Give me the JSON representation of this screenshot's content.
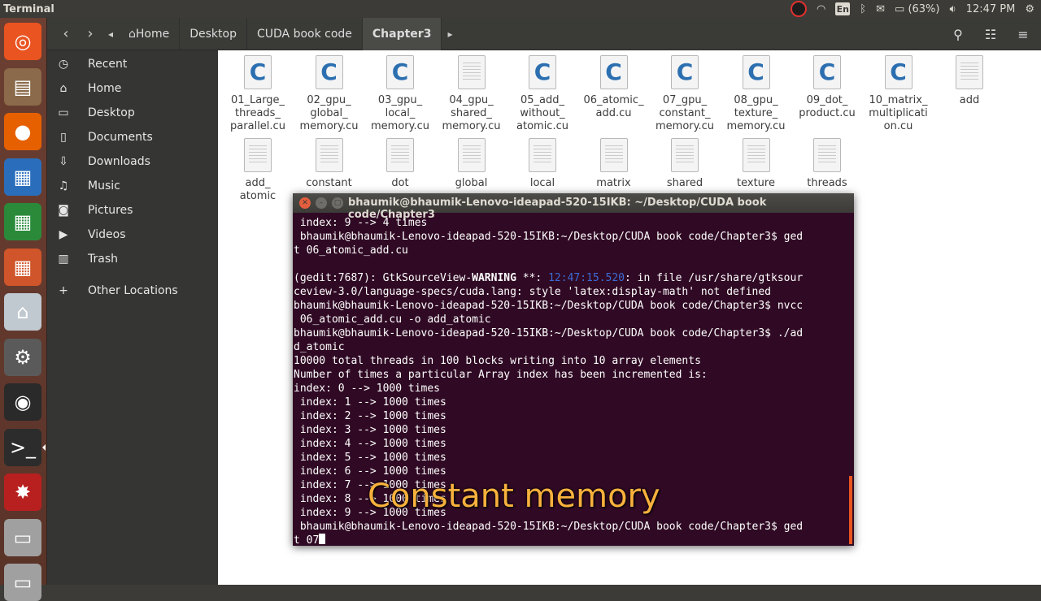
{
  "top_panel": {
    "app_title": "Terminal",
    "keyboard_layout": "En",
    "battery": "(63%)",
    "clock": "12:47 PM"
  },
  "launcher": {
    "items": [
      {
        "name": "ubuntu-dash-icon",
        "glyph": "◎",
        "color": "#e95420"
      },
      {
        "name": "files-icon",
        "glyph": "▤",
        "color": "#8a6a4a"
      },
      {
        "name": "firefox-icon",
        "glyph": "●",
        "color": "#e66000"
      },
      {
        "name": "writer-icon",
        "glyph": "▦",
        "color": "#2a6ebb"
      },
      {
        "name": "calc-icon",
        "glyph": "▦",
        "color": "#2a8a3a"
      },
      {
        "name": "impress-icon",
        "glyph": "▦",
        "color": "#d0552a"
      },
      {
        "name": "software-center-icon",
        "glyph": "⌂",
        "color": "#c0c8d0"
      },
      {
        "name": "system-settings-icon",
        "glyph": "⚙",
        "color": "#5a5a5a"
      },
      {
        "name": "obs-icon",
        "glyph": "◉",
        "color": "#2a2a2a"
      },
      {
        "name": "terminal-icon",
        "glyph": ">_",
        "color": "#2c2c2c"
      },
      {
        "name": "app-icon",
        "glyph": "✸",
        "color": "#b82020"
      },
      {
        "name": "workspace-icon",
        "glyph": "▭",
        "color": "#a0a0a0"
      },
      {
        "name": "trash-launcher-icon",
        "glyph": "▭",
        "color": "#a0a0a0"
      }
    ]
  },
  "files": {
    "breadcrumbs": [
      "Home",
      "Desktop",
      "CUDA book code",
      "Chapter3"
    ],
    "sidebar": [
      {
        "name": "recent",
        "icon": "◷",
        "label": "Recent"
      },
      {
        "name": "home",
        "icon": "⌂",
        "label": "Home"
      },
      {
        "name": "desktop",
        "icon": "▭",
        "label": "Desktop"
      },
      {
        "name": "documents",
        "icon": "▯",
        "label": "Documents"
      },
      {
        "name": "downloads",
        "icon": "⇩",
        "label": "Downloads"
      },
      {
        "name": "music",
        "icon": "♫",
        "label": "Music"
      },
      {
        "name": "pictures",
        "icon": "◙",
        "label": "Pictures"
      },
      {
        "name": "videos",
        "icon": "▶",
        "label": "Videos"
      },
      {
        "name": "trash",
        "icon": "▥",
        "label": "Trash"
      },
      {
        "name": "other-locations",
        "icon": "+",
        "label": "Other Locations"
      }
    ],
    "items": [
      {
        "label": "01_Large_\nthreads_\nparallel.cu",
        "type": "c"
      },
      {
        "label": "02_gpu_\nglobal_\nmemory.cu",
        "type": "c"
      },
      {
        "label": "03_gpu_\nlocal_\nmemory.cu",
        "type": "c"
      },
      {
        "label": "04_gpu_\nshared_\nmemory.cu",
        "type": "text"
      },
      {
        "label": "05_add_\nwithout_\natomic.cu",
        "type": "c"
      },
      {
        "label": "06_atomic_\nadd.cu",
        "type": "c"
      },
      {
        "label": "07_gpu_\nconstant_\nmemory.cu",
        "type": "c"
      },
      {
        "label": "08_gpu_\ntexture_\nmemory.cu",
        "type": "c"
      },
      {
        "label": "09_dot_\nproduct.cu",
        "type": "c"
      },
      {
        "label": "10_matrix_\nmultiplicati\non.cu",
        "type": "c"
      },
      {
        "label": "add",
        "type": "text"
      },
      {
        "label": "add_\natomic",
        "type": "text"
      },
      {
        "label": "constant",
        "type": "text"
      },
      {
        "label": "dot",
        "type": "text"
      },
      {
        "label": "global",
        "type": "text"
      },
      {
        "label": "local",
        "type": "text"
      },
      {
        "label": "matrix",
        "type": "text"
      },
      {
        "label": "shared",
        "type": "text"
      },
      {
        "label": "texture",
        "type": "text"
      },
      {
        "label": "threads",
        "type": "text"
      }
    ]
  },
  "terminal": {
    "title": "bhaumik@bhaumik-Lenovo-ideapad-520-15IKB: ~/Desktop/CUDA book code/Chapter3",
    "lines": [
      " index: 9 --> 4 times",
      " bhaumik@bhaumik-Lenovo-ideapad-520-15IKB:~/Desktop/CUDA book code/Chapter3$ ged",
      "t 06_atomic_add.cu",
      "",
      "__GTKLINE__",
      "ceview-3.0/language-specs/cuda.lang: style 'latex:display-math' not defined",
      "bhaumik@bhaumik-Lenovo-ideapad-520-15IKB:~/Desktop/CUDA book code/Chapter3$ nvcc",
      " 06_atomic_add.cu -o add_atomic",
      "bhaumik@bhaumik-Lenovo-ideapad-520-15IKB:~/Desktop/CUDA book code/Chapter3$ ./ad",
      "d_atomic",
      "10000 total threads in 100 blocks writing into 10 array elements",
      "Number of times a particular Array index has been incremented is:",
      "index: 0 --> 1000 times",
      " index: 1 --> 1000 times",
      " index: 2 --> 1000 times",
      " index: 3 --> 1000 times",
      " index: 4 --> 1000 times",
      " index: 5 --> 1000 times",
      " index: 6 --> 1000 times",
      " index: 7 --> 1000 times",
      " index: 8 --> 1000 times",
      " index: 9 --> 1000 times",
      " bhaumik@bhaumik-Lenovo-ideapad-520-15IKB:~/Desktop/CUDA book code/Chapter3$ ged",
      "t 07"
    ],
    "gtk_prefix": "(gedit:7687): GtkSourceView-",
    "gtk_warning": "WARNING",
    "gtk_mid": " **: ",
    "gtk_time": "12:47:15.520",
    "gtk_suffix": ": in file /usr/share/gtksour"
  },
  "caption": "Constant memory"
}
